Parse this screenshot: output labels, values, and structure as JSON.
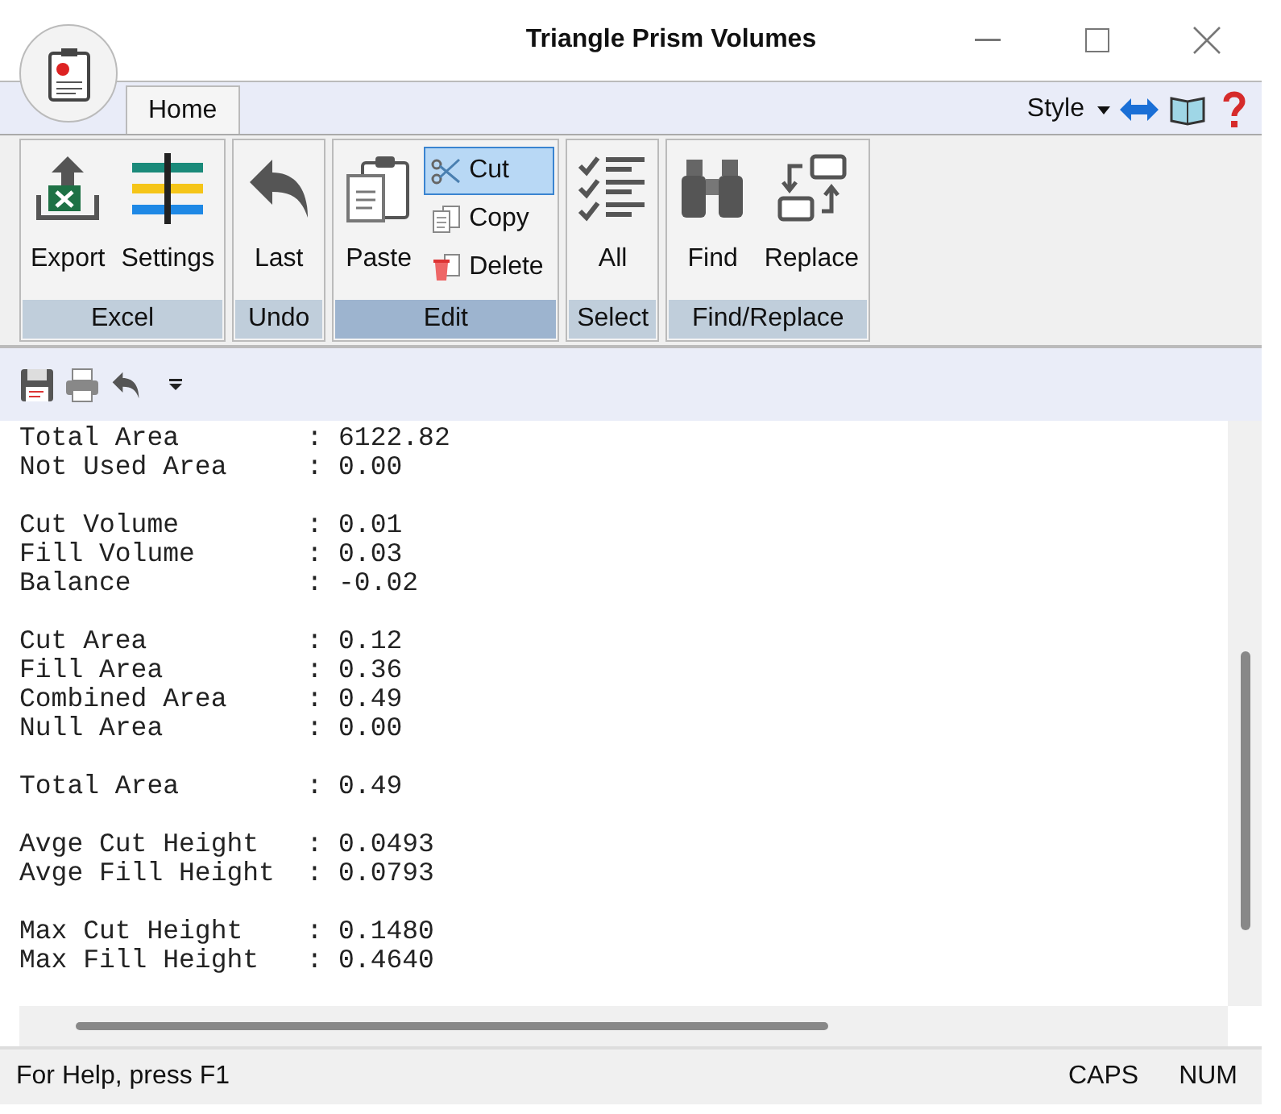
{
  "window": {
    "title": "Triangle Prism Volumes"
  },
  "tabs": [
    {
      "label": "Home",
      "selected": true
    }
  ],
  "style_menu": {
    "label": "Style"
  },
  "ribbon": {
    "groups": [
      {
        "label": "Excel",
        "active": false,
        "buttons": [
          {
            "label": "Export",
            "kind": "export",
            "selected": false
          },
          {
            "label": "Settings",
            "kind": "settings",
            "selected": false
          }
        ]
      },
      {
        "label": "Undo",
        "active": false,
        "buttons": [
          {
            "label": "Last",
            "kind": "undo",
            "selected": false
          }
        ]
      },
      {
        "label": "Edit",
        "active": true,
        "buttons": [
          {
            "label": "Paste",
            "kind": "paste",
            "selected": false
          },
          {
            "label": "Cut",
            "kind": "cut",
            "selected": true
          },
          {
            "label": "Copy",
            "kind": "copy",
            "selected": false
          },
          {
            "label": "Delete",
            "kind": "delete",
            "selected": false
          }
        ]
      },
      {
        "label": "Select",
        "active": false,
        "buttons": [
          {
            "label": "All",
            "kind": "select",
            "selected": false
          }
        ]
      },
      {
        "label": "Find/Replace",
        "active": false,
        "buttons": [
          {
            "label": "Find",
            "kind": "find",
            "selected": false
          },
          {
            "label": "Replace",
            "kind": "replace",
            "selected": false
          }
        ]
      }
    ]
  },
  "report": [
    [
      "Total Area        : 6122.82",
      "Not Used Area     : 0.00"
    ],
    [
      "Cut Volume        : 0.01",
      "Fill Volume       : 0.03",
      "Balance           : -0.02"
    ],
    [
      "Cut Area          : 0.12",
      "Fill Area         : 0.36",
      "Combined Area     : 0.49",
      "Null Area         : 0.00"
    ],
    [
      "Total Area        : 0.49"
    ],
    [
      "Avge Cut Height   : 0.0493",
      "Avge Fill Height  : 0.0793"
    ],
    [
      "Max Cut Height    : 0.1480",
      "Max Fill Height   : 0.4640"
    ]
  ],
  "status_bar": {
    "help": "For Help, press F1",
    "indicators": [
      "CAPS",
      "NUM"
    ]
  }
}
